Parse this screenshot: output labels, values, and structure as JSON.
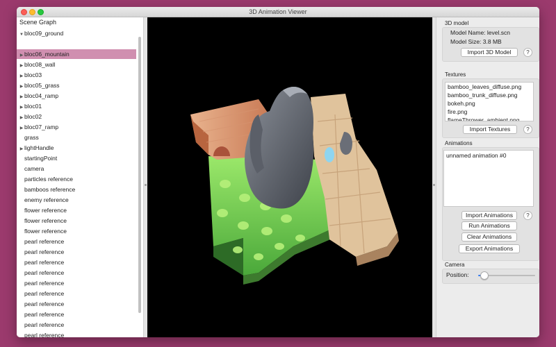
{
  "window": {
    "title": "3D Animation Viewer"
  },
  "sidebar": {
    "header": "Scene Graph",
    "items": [
      {
        "label": "bloc09_ground",
        "arrow": "▼"
      },
      {
        "label": "",
        "arrow": ""
      },
      {
        "label": "bloc06_mountain",
        "arrow": "▶",
        "selected": true
      },
      {
        "label": "bloc08_wall",
        "arrow": "▶"
      },
      {
        "label": "bloc03",
        "arrow": "▶"
      },
      {
        "label": "bloc05_grass",
        "arrow": "▶"
      },
      {
        "label": "bloc04_ramp",
        "arrow": "▶"
      },
      {
        "label": "bloc01",
        "arrow": "▶"
      },
      {
        "label": "bloc02",
        "arrow": "▶"
      },
      {
        "label": "bloc07_ramp",
        "arrow": "▶"
      },
      {
        "label": "grass",
        "arrow": ""
      },
      {
        "label": "lightHandle",
        "arrow": "▶"
      },
      {
        "label": "startingPoint",
        "arrow": ""
      },
      {
        "label": "camera",
        "arrow": ""
      },
      {
        "label": "particles reference",
        "arrow": ""
      },
      {
        "label": "bamboos reference",
        "arrow": ""
      },
      {
        "label": "enemy reference",
        "arrow": ""
      },
      {
        "label": "flower reference",
        "arrow": ""
      },
      {
        "label": "flower reference",
        "arrow": ""
      },
      {
        "label": "flower reference",
        "arrow": ""
      },
      {
        "label": "pearl reference",
        "arrow": ""
      },
      {
        "label": "pearl reference",
        "arrow": ""
      },
      {
        "label": "pearl reference",
        "arrow": ""
      },
      {
        "label": "pearl reference",
        "arrow": ""
      },
      {
        "label": "pearl reference",
        "arrow": ""
      },
      {
        "label": "pearl reference",
        "arrow": ""
      },
      {
        "label": "pearl reference",
        "arrow": ""
      },
      {
        "label": "pearl reference",
        "arrow": ""
      },
      {
        "label": "pearl reference",
        "arrow": ""
      },
      {
        "label": "pearl reference",
        "arrow": ""
      }
    ]
  },
  "inspector": {
    "model": {
      "title": "3D model",
      "name_text": "Model Name: level.scn",
      "size_text": "Model Size: 3.8 MB",
      "import_label": "Import 3D Model",
      "help": "?"
    },
    "textures": {
      "title": "Textures",
      "items": [
        "bamboo_leaves_diffuse.png",
        "bamboo_trunk_diffuse.png",
        "bokeh.png",
        "fire.png",
        "flameThrower_ambient.png"
      ],
      "import_label": "Import Textures",
      "help": "?"
    },
    "animations": {
      "title": "Animations",
      "items": [
        "unnamed animation #0"
      ],
      "import_label": "Import Animations",
      "run_label": "Run Animations",
      "clear_label": "Clear Animations",
      "export_label": "Export Animations",
      "help": "?"
    },
    "camera": {
      "title": "Camera",
      "position_label": "Position:",
      "position_value": 0.1
    }
  },
  "colors": {
    "desktop": "#9b3a6d",
    "selection": "#d08fb0",
    "accent": "#3b7ff0"
  }
}
